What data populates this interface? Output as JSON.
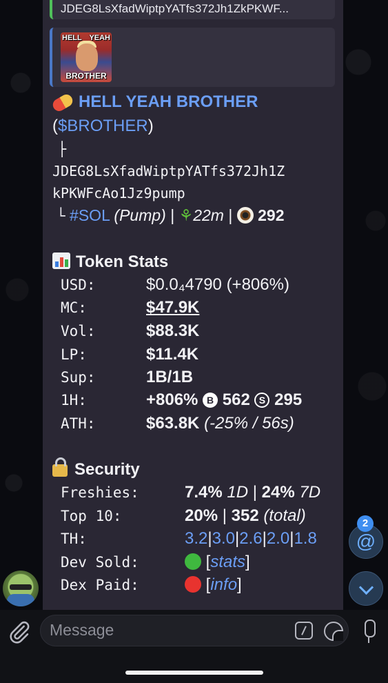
{
  "message": {
    "reply_text": "JDEG8LsXfadWiptpYATfs372Jh1ZkPKWF...",
    "thumb": {
      "top_left": "HELL",
      "top_right": "YEAH",
      "bottom": "BROTHER"
    },
    "token_name": "HELL YEAH BROTHER",
    "ticker_open": "(",
    "ticker": "$BROTHER",
    "ticker_close": ")",
    "branch": "├",
    "address_1": "JDEG8LsXfadWiptpYATfs372Jh1Z",
    "address_2": "kPKWFcAo1Jz9pump",
    "end_branch": "└",
    "chain": "#SOL",
    "platform": "(Pump)",
    "sep": "|",
    "age": "22m",
    "views": "292",
    "stats_title": "Token Stats",
    "stats": [
      {
        "k": "USD:",
        "v": "$0.0₄4790 (+806%)"
      },
      {
        "k": "MC:",
        "v": "$47.9K"
      },
      {
        "k": "Vol:",
        "v": "$88.3K"
      },
      {
        "k": "LP:",
        "v": "$11.4K"
      },
      {
        "k": "Sup:",
        "v": "1B/1B"
      },
      {
        "k": "1H:",
        "v": "+806%",
        "buys": "562",
        "sells": "295"
      },
      {
        "k": "ATH:",
        "v": "$63.8K",
        "v2": "(-25% / 56s)"
      }
    ],
    "security_title": "Security",
    "security": {
      "freshies_k": "Freshies:",
      "freshies_1d": "7.4%",
      "freshies_1d_label": "1D",
      "freshies_7d": "24%",
      "freshies_7d_label": "7D",
      "top10_k": "Top 10:",
      "top10_pct": "20%",
      "top10_total": "352",
      "top10_total_label": "(total)",
      "th_k": "TH:",
      "th_values": [
        "3.2",
        "3.0",
        "2.6",
        "2.0",
        "1.8"
      ],
      "dev_k": "Dev Sold:",
      "dev_link": "stats",
      "dex_k": "Dex Paid:",
      "dex_link": "info"
    }
  },
  "floating": {
    "mention_count": "2",
    "mention_symbol": "@"
  },
  "composer": {
    "placeholder": "Message"
  },
  "colors": {
    "bubble": "#2a2734",
    "link": "#6b9ef5",
    "green": "#3fb83f",
    "red": "#e8332f"
  }
}
